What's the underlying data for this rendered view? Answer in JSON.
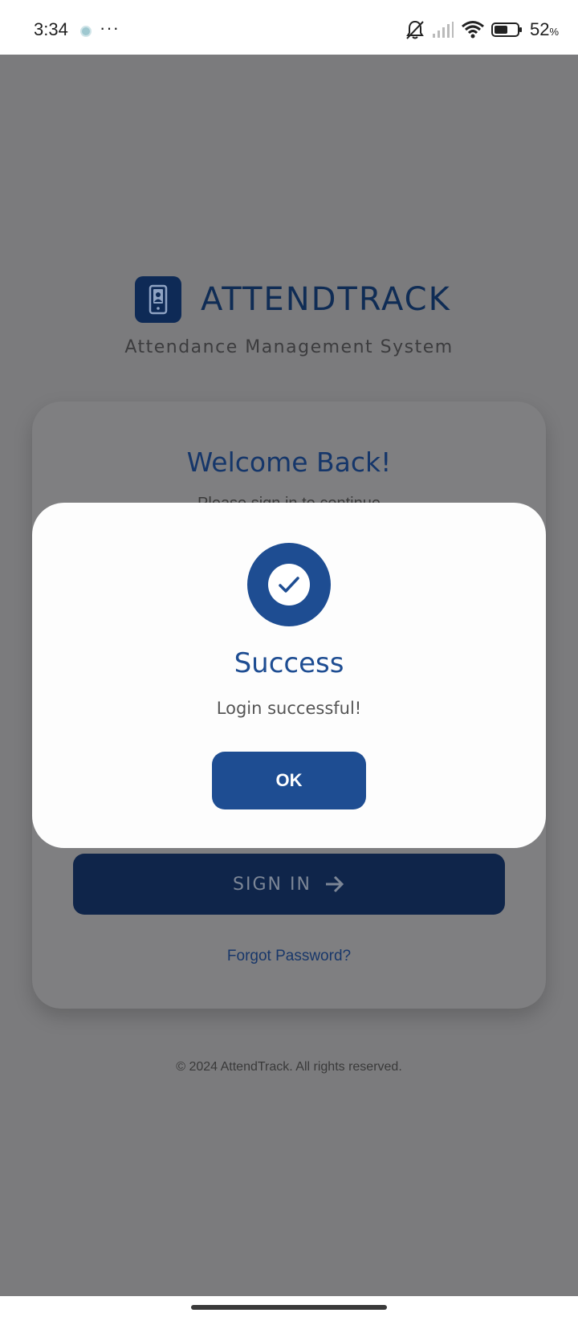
{
  "status_bar": {
    "time": "3:34",
    "more": "···",
    "battery_percent": "52",
    "battery_unit": "%",
    "icons": [
      "notification-dot-icon",
      "mute-bell-icon",
      "signal-icon",
      "wifi-icon",
      "battery-icon"
    ]
  },
  "brand": {
    "name": "ATTENDTRACK",
    "tagline": "Attendance Management System",
    "logo_icon": "phone-user-icon"
  },
  "login_card": {
    "title": "Welcome Back!",
    "subtitle": "Please sign in to continue",
    "signin_label": "SIGN IN",
    "signin_icon": "arrow-right-icon",
    "forgot_label": "Forgot Password?"
  },
  "footer": {
    "copyright": "© 2024 AttendTrack. All rights reserved."
  },
  "dialog": {
    "icon": "check-icon",
    "title": "Success",
    "message": "Login successful!",
    "ok_label": "OK"
  },
  "colors": {
    "primary": "#1e4d92",
    "navy": "#0f254a",
    "overlay": "#7b7b7d",
    "dialog_bg": "#fdfdfd"
  }
}
